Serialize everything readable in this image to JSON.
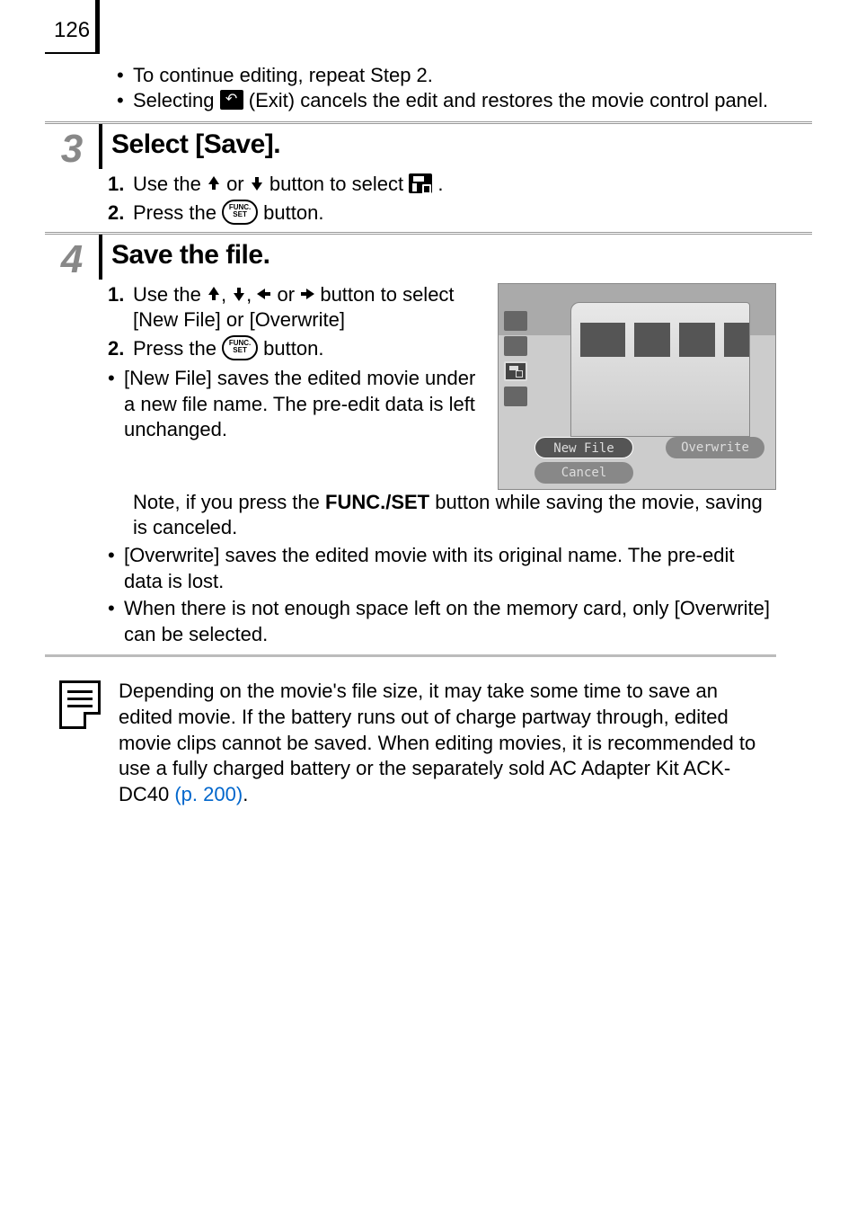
{
  "page_number": "126",
  "intro_bullets": [
    {
      "pre": "To continue editing, repeat Step 2."
    },
    {
      "pre": "Selecting ",
      "post": " (Exit) cancels the edit and restores the movie control panel.",
      "has_exit_icon": true
    }
  ],
  "step3": {
    "num": "3",
    "title": "Select [Save].",
    "sub1_num": "1.",
    "sub1_a": "Use the ",
    "sub1_b": " or ",
    "sub1_c": " button to select ",
    "sub1_d": ".",
    "sub2_num": "2.",
    "sub2_a": "Press the ",
    "sub2_b": " button.",
    "func_label_top": "FUNC.",
    "func_label_bot": "SET"
  },
  "step4": {
    "num": "4",
    "title": "Save the file.",
    "sub1_num": "1.",
    "sub1_a": "Use the ",
    "sub1_b": ", ",
    "sub1_c": ", ",
    "sub1_d": " or ",
    "sub1_e": " button to select [New File] or [Overwrite]",
    "sub2_num": "2.",
    "sub2_a": "Press the ",
    "sub2_b": " button.",
    "func_label_top": "FUNC.",
    "func_label_bot": "SET",
    "b1a": "[New File] saves the edited movie under a new file name. The pre-edit data is left unchanged.",
    "b1b_a": "Note, if you press the ",
    "b1b_bold": "FUNC./SET",
    "b1b_b": " button while saving the movie, saving is canceled.",
    "b2": "[Overwrite] saves the edited movie with its original name. The pre-edit data is lost.",
    "b3": "When there is not enough space left on the memory card, only [Overwrite] can be selected."
  },
  "screenshot": {
    "new_file": "New File",
    "overwrite": "Overwrite",
    "cancel": "Cancel"
  },
  "note": {
    "text_a": "Depending on the movie's file size, it may take some time to save an edited movie. If the battery runs out of charge partway through, edited movie clips cannot be saved. When editing movies, it is recommended to use a fully charged battery or the separately sold AC Adapter Kit ACK-DC40 ",
    "link": "(p. 200)",
    "text_b": "."
  }
}
